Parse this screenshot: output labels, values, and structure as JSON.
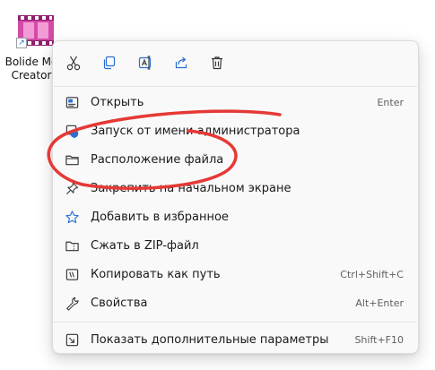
{
  "desktop_icon": {
    "label_line1": "Bolide Mo",
    "label_line2": "Creator"
  },
  "colors": {
    "accent_blue": "#2a6fd6",
    "annotation_red": "#e53935",
    "film_pink": "#d44aa8"
  },
  "toolbar": {
    "buttons": [
      {
        "icon": "cut-icon"
      },
      {
        "icon": "copy-icon"
      },
      {
        "icon": "rename-icon"
      },
      {
        "icon": "share-icon"
      },
      {
        "icon": "delete-icon"
      }
    ]
  },
  "menu": {
    "items": [
      {
        "label": "Открыть",
        "shortcut": "Enter",
        "icon": "open-icon"
      },
      {
        "label": "Запуск от имени администратора",
        "shortcut": "",
        "icon": "admin-shield-icon"
      },
      {
        "label": "Расположение файла",
        "shortcut": "",
        "icon": "folder-icon"
      },
      {
        "label": "Закрепить на начальном экране",
        "shortcut": "",
        "icon": "pin-icon"
      },
      {
        "label": "Добавить в избранное",
        "shortcut": "",
        "icon": "star-icon"
      },
      {
        "label": "Сжать в ZIP-файл",
        "shortcut": "",
        "icon": "zip-folder-icon"
      },
      {
        "label": "Копировать как путь",
        "shortcut": "Ctrl+Shift+C",
        "icon": "copy-path-icon"
      },
      {
        "label": "Свойства",
        "shortcut": "Alt+Enter",
        "icon": "wrench-icon"
      },
      {
        "label": "Показать дополнительные параметры",
        "shortcut": "Shift+F10",
        "icon": "more-options-icon"
      }
    ]
  }
}
